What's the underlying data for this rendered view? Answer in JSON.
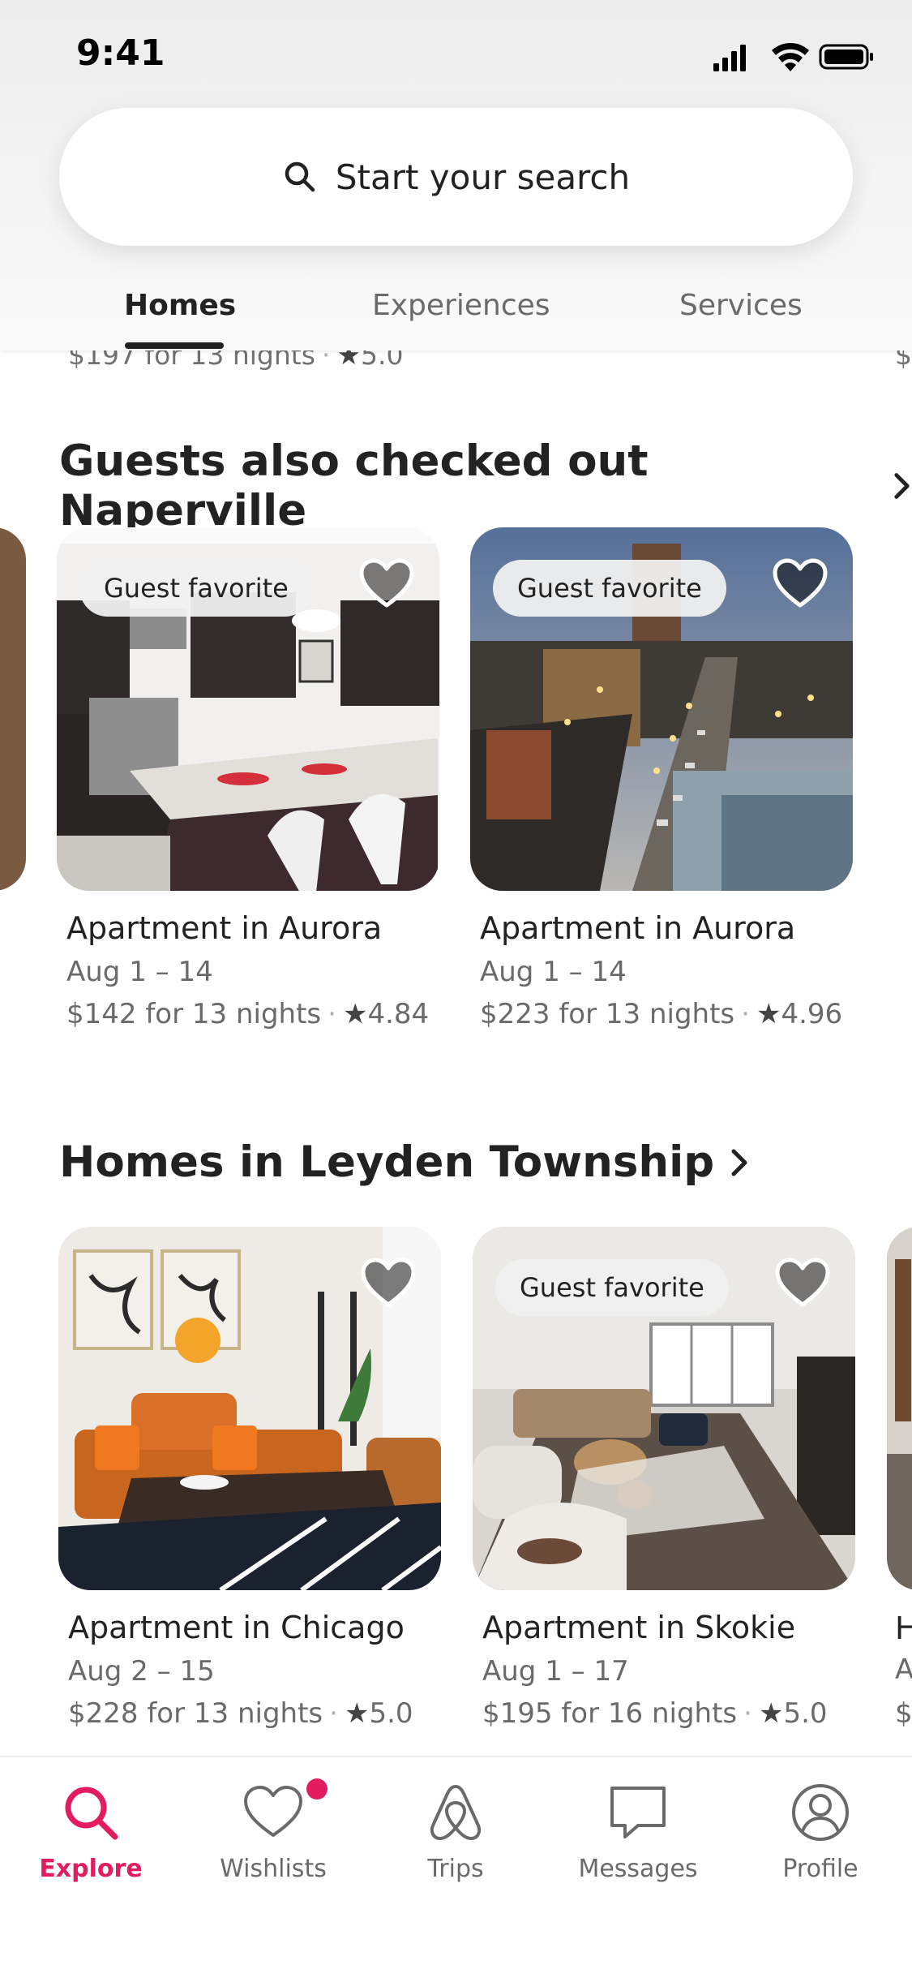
{
  "status": {
    "time": "9:41"
  },
  "search": {
    "placeholder": "Start your search"
  },
  "tabs": [
    {
      "label": "Homes",
      "active": true
    },
    {
      "label": "Experiences",
      "active": false
    },
    {
      "label": "Services",
      "active": false
    }
  ],
  "peek_row": {
    "price": "$197 for 13 nights",
    "rating": "5.0",
    "right_fragment": "$"
  },
  "sections": [
    {
      "title": "Guests also checked out Naperville",
      "cards": [
        {
          "badge": "Guest favorite",
          "title": "Apartment in Aurora",
          "dates": "Aug 1 – 14",
          "price": "$142 for 13 nights",
          "rating": "4.84"
        },
        {
          "badge": "Guest favorite",
          "title": "Apartment in Aurora",
          "dates": "Aug 1 – 14",
          "price": "$223 for 13 nights",
          "rating": "4.96"
        }
      ]
    },
    {
      "title": "Homes in Leyden Township",
      "cards": [
        {
          "badge": "",
          "title": "Apartment in Chicago",
          "dates": "Aug 2 – 15",
          "price": "$228 for 13 nights",
          "rating": "5.0"
        },
        {
          "badge": "Guest favorite",
          "title": "Apartment in Skokie",
          "dates": "Aug 1 – 17",
          "price": "$195 for 16 nights",
          "rating": "5.0"
        }
      ],
      "peek_fragments": {
        "title": "H",
        "dates": "A",
        "price": "$"
      }
    }
  ],
  "tabbar": [
    {
      "label": "Explore",
      "icon": "search-icon",
      "active": true
    },
    {
      "label": "Wishlists",
      "icon": "heart-icon",
      "active": false,
      "notification": true
    },
    {
      "label": "Trips",
      "icon": "airbnb-logo-icon",
      "active": false
    },
    {
      "label": "Messages",
      "icon": "message-icon",
      "active": false
    },
    {
      "label": "Profile",
      "icon": "profile-icon",
      "active": false
    }
  ],
  "colors": {
    "accent": "#E31C5F",
    "text": "#222222",
    "muted": "#6A6A6A"
  }
}
